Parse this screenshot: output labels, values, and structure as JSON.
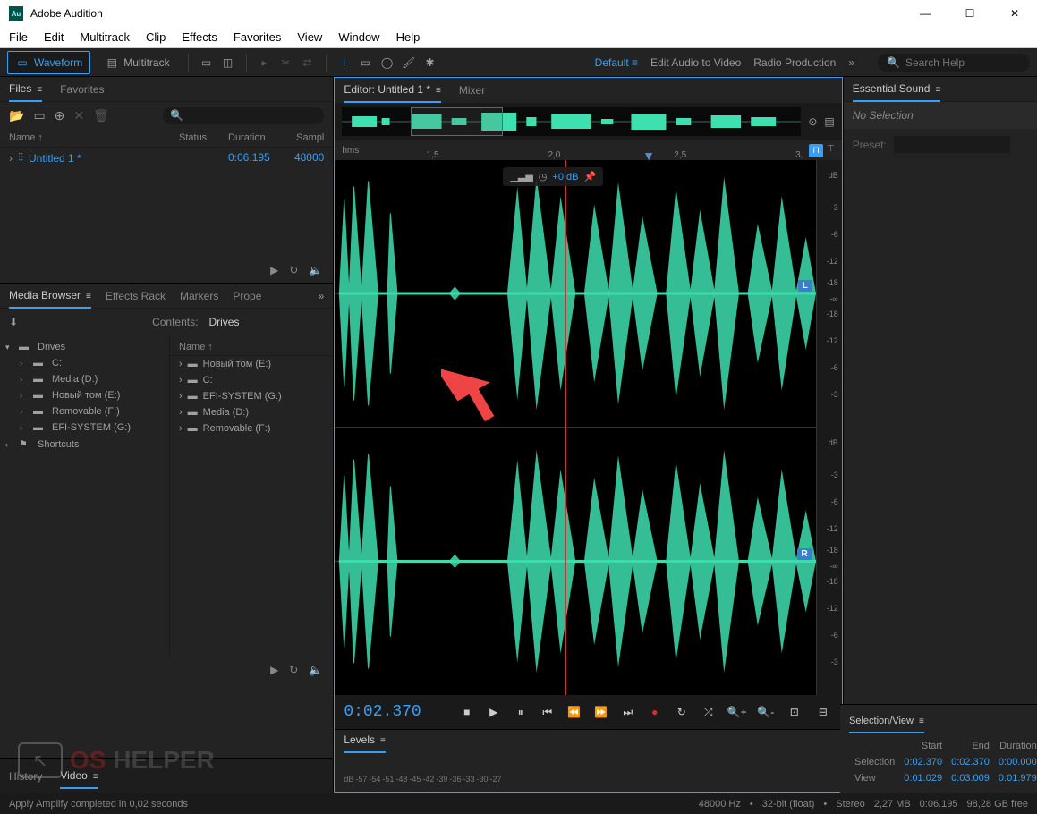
{
  "app": {
    "title": "Adobe Audition",
    "icon": "Au"
  },
  "menus": [
    "File",
    "Edit",
    "Multitrack",
    "Clip",
    "Effects",
    "Favorites",
    "View",
    "Window",
    "Help"
  ],
  "toolbar": {
    "waveform": "Waveform",
    "multitrack": "Multitrack",
    "workspace": "Default",
    "links": [
      "Edit Audio to Video",
      "Radio Production"
    ],
    "search_placeholder": "Search Help"
  },
  "files": {
    "tabs": [
      "Files",
      "Favorites"
    ],
    "columns": {
      "name": "Name ↑",
      "status": "Status",
      "duration": "Duration",
      "sample": "Sampl"
    },
    "rows": [
      {
        "name": "Untitled 1 *",
        "status": "",
        "duration": "0:06.195",
        "sample": "48000"
      }
    ]
  },
  "media": {
    "tabs": [
      "Media Browser",
      "Effects Rack",
      "Markers",
      "Prope"
    ],
    "contents_label": "Contents:",
    "contents_value": "Drives",
    "tree": [
      {
        "label": "Drives",
        "depth": 0,
        "expanded": true
      },
      {
        "label": "C:",
        "depth": 1,
        "expanded": false
      },
      {
        "label": "Media (D:)",
        "depth": 1,
        "expanded": false
      },
      {
        "label": "Новый том (E:)",
        "depth": 1,
        "expanded": false
      },
      {
        "label": "Removable (F:)",
        "depth": 1,
        "expanded": false
      },
      {
        "label": "EFI-SYSTEM (G:)",
        "depth": 1,
        "expanded": false
      },
      {
        "label": "Shortcuts",
        "depth": 0,
        "expanded": false
      }
    ],
    "list_header": "Name ↑",
    "list": [
      "Новый том (E:)",
      "C:",
      "EFI-SYSTEM (G:)",
      "Media (D:)",
      "Removable (F:)"
    ]
  },
  "bottom_tabs": [
    "History",
    "Video"
  ],
  "editor": {
    "tab": "Editor: Untitled 1 *",
    "mixer": "Mixer",
    "ruler_unit": "hms",
    "ruler_ticks": [
      "1,5",
      "2,0",
      "2,5",
      "3,"
    ],
    "hud_db": "+0 dB",
    "db_label": "dB",
    "db_marks": [
      "-3",
      "-6",
      "-12",
      "-18",
      "-∞",
      "-18",
      "-12",
      "-6",
      "-3"
    ],
    "ch_left": "L",
    "ch_right": "R",
    "time": "0:02.370"
  },
  "levels": {
    "title": "Levels",
    "scale": [
      "dB",
      "-57",
      "-54",
      "-51",
      "-48",
      "-45",
      "-42",
      "-39",
      "-36",
      "-33",
      "-30",
      "-27"
    ]
  },
  "essential": {
    "title": "Essential Sound",
    "no_selection": "No Selection",
    "preset_label": "Preset:"
  },
  "selview": {
    "title": "Selection/View",
    "cols": [
      "Start",
      "End",
      "Duration"
    ],
    "rows": [
      {
        "label": "Selection",
        "start": "0:02.370",
        "end": "0:02.370",
        "dur": "0:00.000"
      },
      {
        "label": "View",
        "start": "0:01.029",
        "end": "0:03.009",
        "dur": "0:01.979"
      }
    ]
  },
  "status": {
    "left": "Apply Amplify completed in 0,02 seconds",
    "sample_rate": "48000 Hz",
    "bit_depth": "32-bit (float)",
    "channels": "Stereo",
    "size": "2,27 MB",
    "duration": "0:06.195",
    "disk": "98,28 GB free"
  },
  "watermark": {
    "os": "OS",
    "helper": " HELPER"
  }
}
